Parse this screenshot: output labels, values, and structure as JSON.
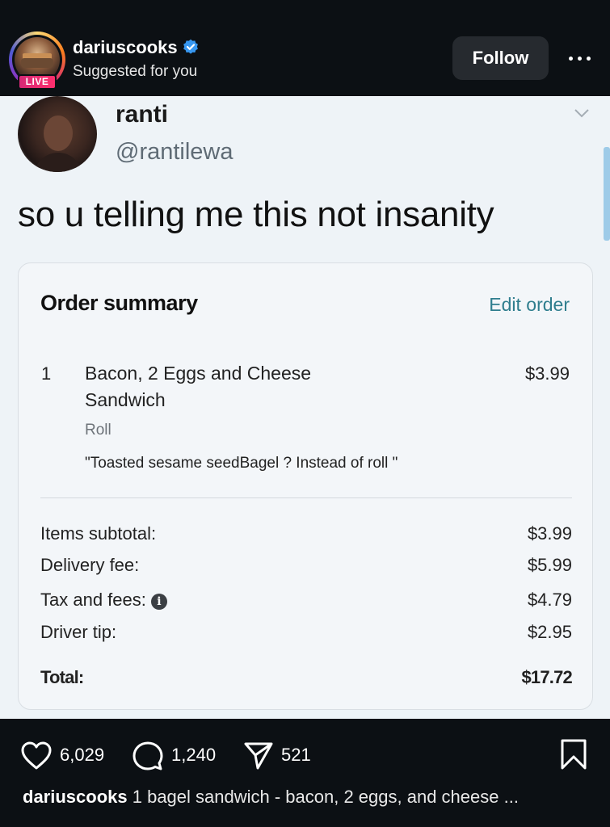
{
  "header": {
    "username": "dariuscooks",
    "subtitle": "Suggested for you",
    "live_label": "LIVE",
    "follow_label": "Follow"
  },
  "tweet": {
    "name": "ranti",
    "handle": "@rantilewa",
    "text": "so u telling me this not insanity",
    "order": {
      "title": "Order summary",
      "edit_label": "Edit order",
      "item": {
        "qty": "1",
        "name": "Bacon, 2 Eggs and Cheese Sandwich",
        "price": "$3.99",
        "option": "Roll",
        "note": "\"Toasted sesame seedBagel ? Instead of roll \""
      },
      "rows": [
        {
          "label": "Items subtotal:",
          "value": "$3.99"
        },
        {
          "label": "Delivery fee:",
          "value": "$5.99"
        },
        {
          "label": "Tax and fees:",
          "value": "$4.79"
        },
        {
          "label": "Driver tip:",
          "value": "$2.95"
        }
      ],
      "total_label": "Total:",
      "total_value": "$17.72"
    }
  },
  "actions": {
    "likes": "6,029",
    "comments": "1,240",
    "shares": "521"
  },
  "caption": {
    "username": "dariuscooks",
    "text": "1 bagel sandwich - bacon, 2 eggs, and cheese ..."
  },
  "colors": {
    "background": "#0c1014",
    "verified": "#3797f0",
    "edit_link": "#2f7e8e"
  }
}
